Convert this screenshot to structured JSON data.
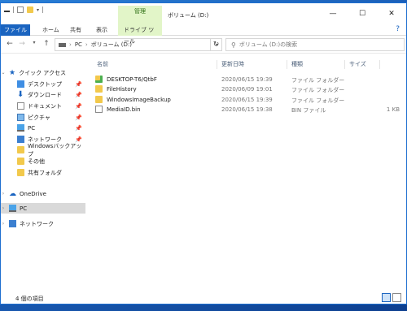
{
  "window": {
    "title": "ボリューム (D:)",
    "context_group": "管理",
    "controls": {
      "minimize": "—",
      "maximize": "☐",
      "close": "✕"
    }
  },
  "ribbon": {
    "tabs": [
      "ファイル",
      "ホーム",
      "共有",
      "表示",
      "ドライブ ツール"
    ],
    "help": "?"
  },
  "address": {
    "path": [
      "PC",
      "ボリューム (D:)"
    ],
    "search_placeholder": "ボリューム (D:)の検索"
  },
  "nav_pane": {
    "quick_access": "クイック アクセス",
    "pinned": [
      "デスクトップ",
      "ダウンロード",
      "ドキュメント",
      "ピクチャ",
      "PC",
      "ネットワーク"
    ],
    "folders": [
      "Windowsバックアップ",
      "その他",
      "共有フォルダ"
    ],
    "onedrive": "OneDrive",
    "pc": "PC",
    "network": "ネットワーク"
  },
  "file_list": {
    "columns": [
      "名前",
      "更新日時",
      "種類",
      "サイズ"
    ],
    "rows": [
      {
        "name": "DESKTOP-T6/QtbF",
        "date": "2020/06/15 19:39",
        "type": "ファイル フォルダー",
        "size": "",
        "icon": "folder-sync-icon"
      },
      {
        "name": "FileHistory",
        "date": "2020/06/09 19:01",
        "type": "ファイル フォルダー",
        "size": "",
        "icon": "folder-icon"
      },
      {
        "name": "WindowsImageBackup",
        "date": "2020/06/15 19:39",
        "type": "ファイル フォルダー",
        "size": "",
        "icon": "folder-icon"
      },
      {
        "name": "MediaID.bin",
        "date": "2020/06/15 19:38",
        "type": "BIN ファイル",
        "size": "1 KB",
        "icon": "file-icon"
      }
    ]
  },
  "status": {
    "item_count": "4 個の項目"
  },
  "colors": {
    "accent": "#1a64c0",
    "context_tab": "#e2f5c8",
    "folder": "#f2c94c"
  }
}
